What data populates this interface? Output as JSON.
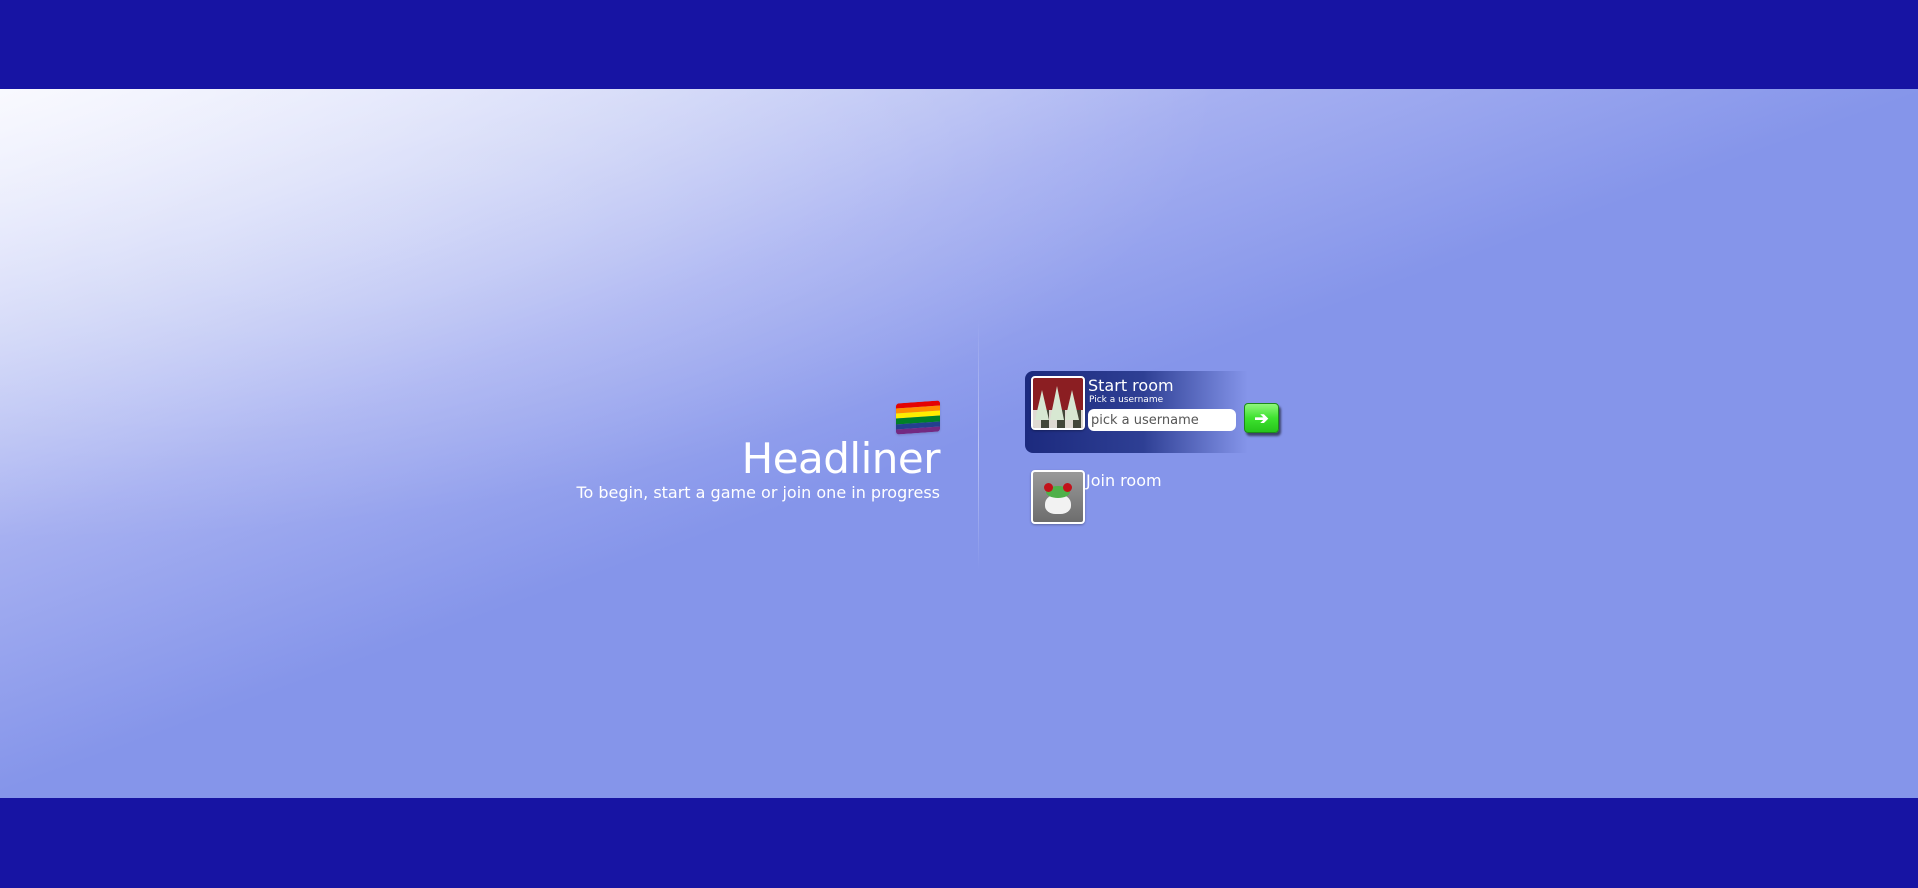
{
  "intro": {
    "title": "Headliner",
    "subtitle": "To begin, start a game or join one in progress",
    "flag_icon": "rainbow-flag-icon",
    "flag_colors": [
      "#e40303",
      "#ff8c00",
      "#ffed00",
      "#008026",
      "#24408e",
      "#732982"
    ]
  },
  "start_room": {
    "title": "Start room",
    "hint": "Pick a username",
    "input_placeholder": "pick a username",
    "input_value": "",
    "submit_icon": "arrow-right-icon",
    "submit_glyph": "➔"
  },
  "join_room": {
    "title": "Join room"
  },
  "colors": {
    "bar": "#1714a3",
    "background": "#8595ea",
    "card": "#1c2a7e",
    "go_button": "#3ee22f"
  }
}
